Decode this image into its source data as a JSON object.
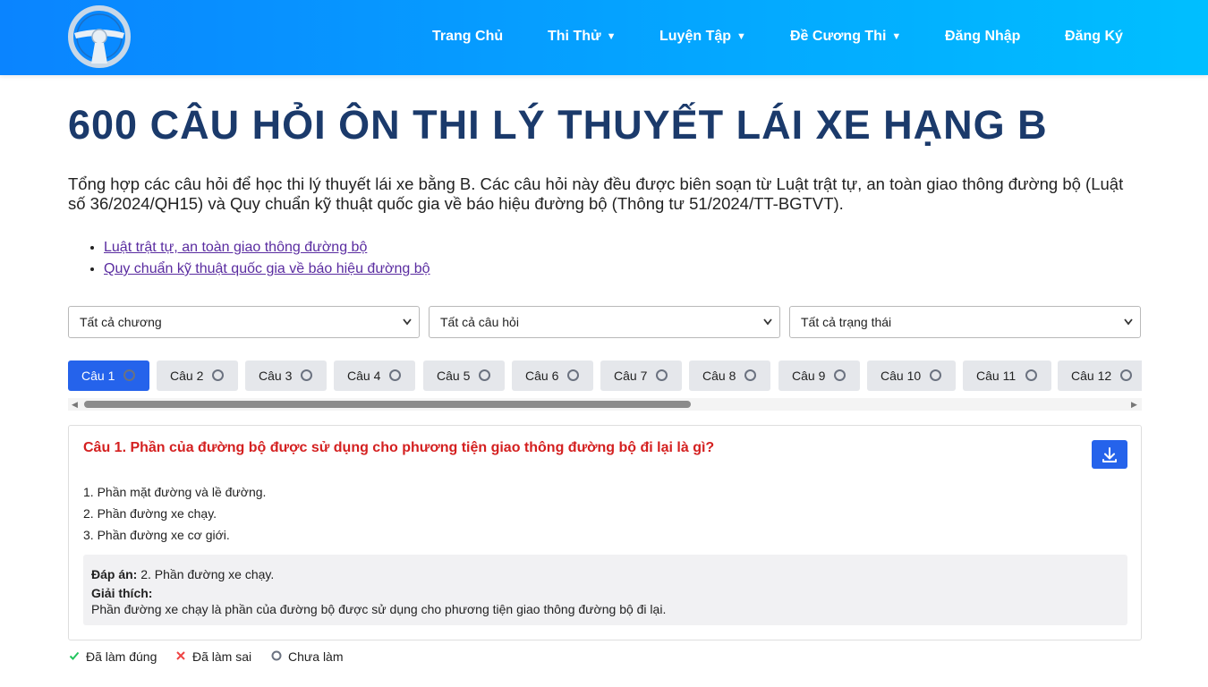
{
  "header": {
    "logo_icon": "steering-wheel-icon",
    "nav": [
      {
        "label": "Trang Chủ",
        "dropdown": false
      },
      {
        "label": "Thi Thử",
        "dropdown": true
      },
      {
        "label": "Luyện Tập",
        "dropdown": true
      },
      {
        "label": "Đề Cương Thi",
        "dropdown": true
      },
      {
        "label": "Đăng Nhập",
        "dropdown": false
      },
      {
        "label": "Đăng Ký",
        "dropdown": false
      }
    ],
    "caret": "▼"
  },
  "main": {
    "title": "600 CÂU HỎI ÔN THI LÝ THUYẾT LÁI XE HẠNG B",
    "intro": "Tổng hợp các câu hỏi để học thi lý thuyết lái xe bằng B. Các câu hỏi này đều được biên soạn từ Luật trật tự, an toàn giao thông đường bộ (Luật số 36/2024/QH15) và Quy chuẩn kỹ thuật quốc gia về báo hiệu đường bộ (Thông tư 51/2024/TT-BGTVT).",
    "links": [
      "Luật trật tự, an toàn giao thông đường bộ",
      "Quy chuẩn kỹ thuật quốc gia về báo hiệu đường bộ"
    ]
  },
  "filters": {
    "chapter": "Tất cả chương",
    "questions": "Tất cả câu hỏi",
    "status": "Tất cả trạng thái"
  },
  "tabs": [
    {
      "label": "Câu 1",
      "active": true
    },
    {
      "label": "Câu 2",
      "active": false
    },
    {
      "label": "Câu 3",
      "active": false
    },
    {
      "label": "Câu 4",
      "active": false
    },
    {
      "label": "Câu 5",
      "active": false
    },
    {
      "label": "Câu 6",
      "active": false
    },
    {
      "label": "Câu 7",
      "active": false
    },
    {
      "label": "Câu 8",
      "active": false
    },
    {
      "label": "Câu 9",
      "active": false
    },
    {
      "label": "Câu 10",
      "active": false
    },
    {
      "label": "Câu 11",
      "active": false
    },
    {
      "label": "Câu 12",
      "active": false
    }
  ],
  "question": {
    "title": "Câu 1. Phần của đường bộ được sử dụng cho phương tiện giao thông đường bộ đi lại là gì?",
    "options": [
      "1. Phần mặt đường và lề đường.",
      "2. Phần đường xe chạy.",
      "3. Phần đường xe cơ giới."
    ],
    "answer_label": "Đáp án:",
    "answer_value": "2. Phần đường xe chạy.",
    "explain_label": "Giải thích:",
    "explain_text": "Phần đường xe chạy là phần của đường bộ được sử dụng cho phương tiện giao thông đường bộ đi lại.",
    "download_icon": "download-icon"
  },
  "legend": {
    "correct": "Đã làm đúng",
    "wrong": "Đã làm sai",
    "pending": "Chưa làm",
    "correct_color": "#22c55e",
    "wrong_color": "#ef4444",
    "pending_color": "#6b7280"
  },
  "colors": {
    "header_start": "#0a84ff",
    "header_end": "#00bfff",
    "title": "#1b3a6b",
    "accent": "#2563eb",
    "question": "#d42020",
    "link": "#5a2ca0"
  }
}
